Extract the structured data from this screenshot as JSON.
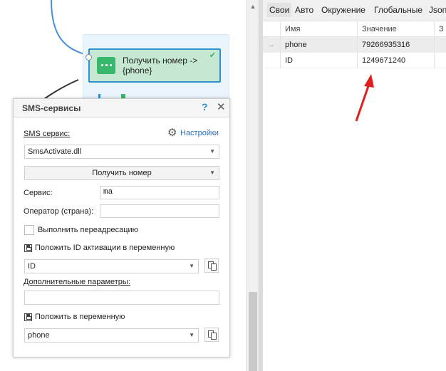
{
  "node": {
    "title": "Получить номер -> {phone}",
    "check": "✔"
  },
  "dialog": {
    "title": "SMS-сервисы",
    "help": "?",
    "close": "✕",
    "sms_service_label": "SMS сервис:",
    "settings_label": "Настройки",
    "sms_service_value": "SmsActivate.dll",
    "action_value": "Получить номер",
    "service_label": "Сервис:",
    "service_value": "ma",
    "operator_label": "Оператор (страна):",
    "operator_value": "",
    "redirect_label": "Выполнить переадресацию",
    "save_id_label": "Положить ID активации в переменную",
    "id_var_value": "ID",
    "extra_params_label": "Дополнительные параметры:",
    "extra_params_value": "",
    "save_to_var_label": "Положить в переменную",
    "phone_var_value": "phone"
  },
  "right_panel": {
    "tabs": [
      "Свои",
      "Авто",
      "Окружение",
      "Глобальные",
      "Json"
    ],
    "columns": [
      "Имя",
      "Значение",
      "З"
    ],
    "rows": [
      {
        "marker": "→",
        "name": "phone",
        "value": "79266935316"
      },
      {
        "marker": "",
        "name": "ID",
        "value": "1249671240"
      }
    ]
  },
  "scrollbar": {
    "up_arrow": "▲"
  },
  "colors": {
    "accent_blue": "#2f8fcf",
    "node_green": "#37b86a",
    "annotation_red": "#e02020"
  }
}
